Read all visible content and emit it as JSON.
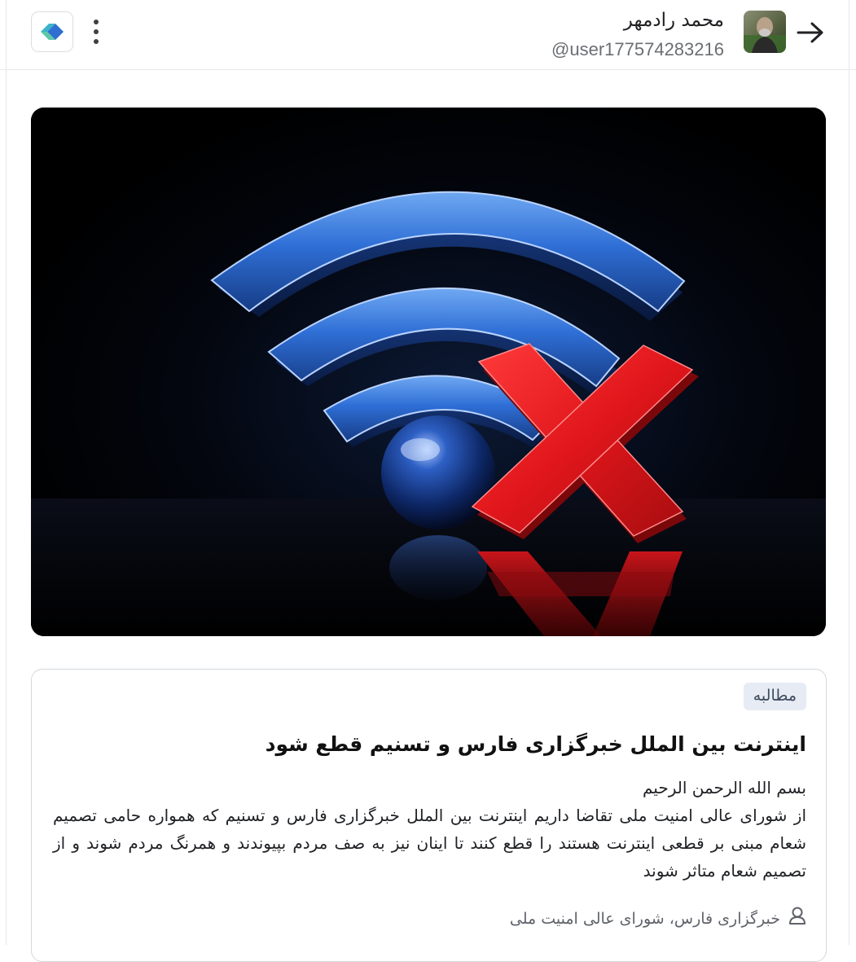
{
  "header": {
    "user_name": "محمد رادمهر",
    "user_handle": "@user177574283216",
    "back_icon": "arrow-right-icon",
    "logo_icon": "app-logo-icon",
    "menu_icon": "more-vertical-icon"
  },
  "hero": {
    "image_icon": "wifi-disconnected-icon",
    "colors": {
      "wifi": "#2f6fd6",
      "cross": "#e0161b",
      "background": "#000000"
    }
  },
  "card": {
    "tag": "مطالبه",
    "title": "اینترنت بین الملل خبرگزاری فارس و تسنیم قطع شود",
    "greeting": "بسم الله الرحمن الرحیم",
    "body": "از شورای عالی امنیت ملی تقاضا داریم اینترنت بین الملل خبرگزاری فارس و تسنیم که همواره حامی تصمیم شعام مبنی بر قطعی اینترنت هستند را قطع کنند تا اینان نیز به صف مردم بپیوندند و همرنگ مردم شوند و از تصمیم شعام متاثر شوند",
    "source_icon": "person-icon",
    "source": "خبرگزاری فارس، شورای عالی امنیت ملی"
  }
}
